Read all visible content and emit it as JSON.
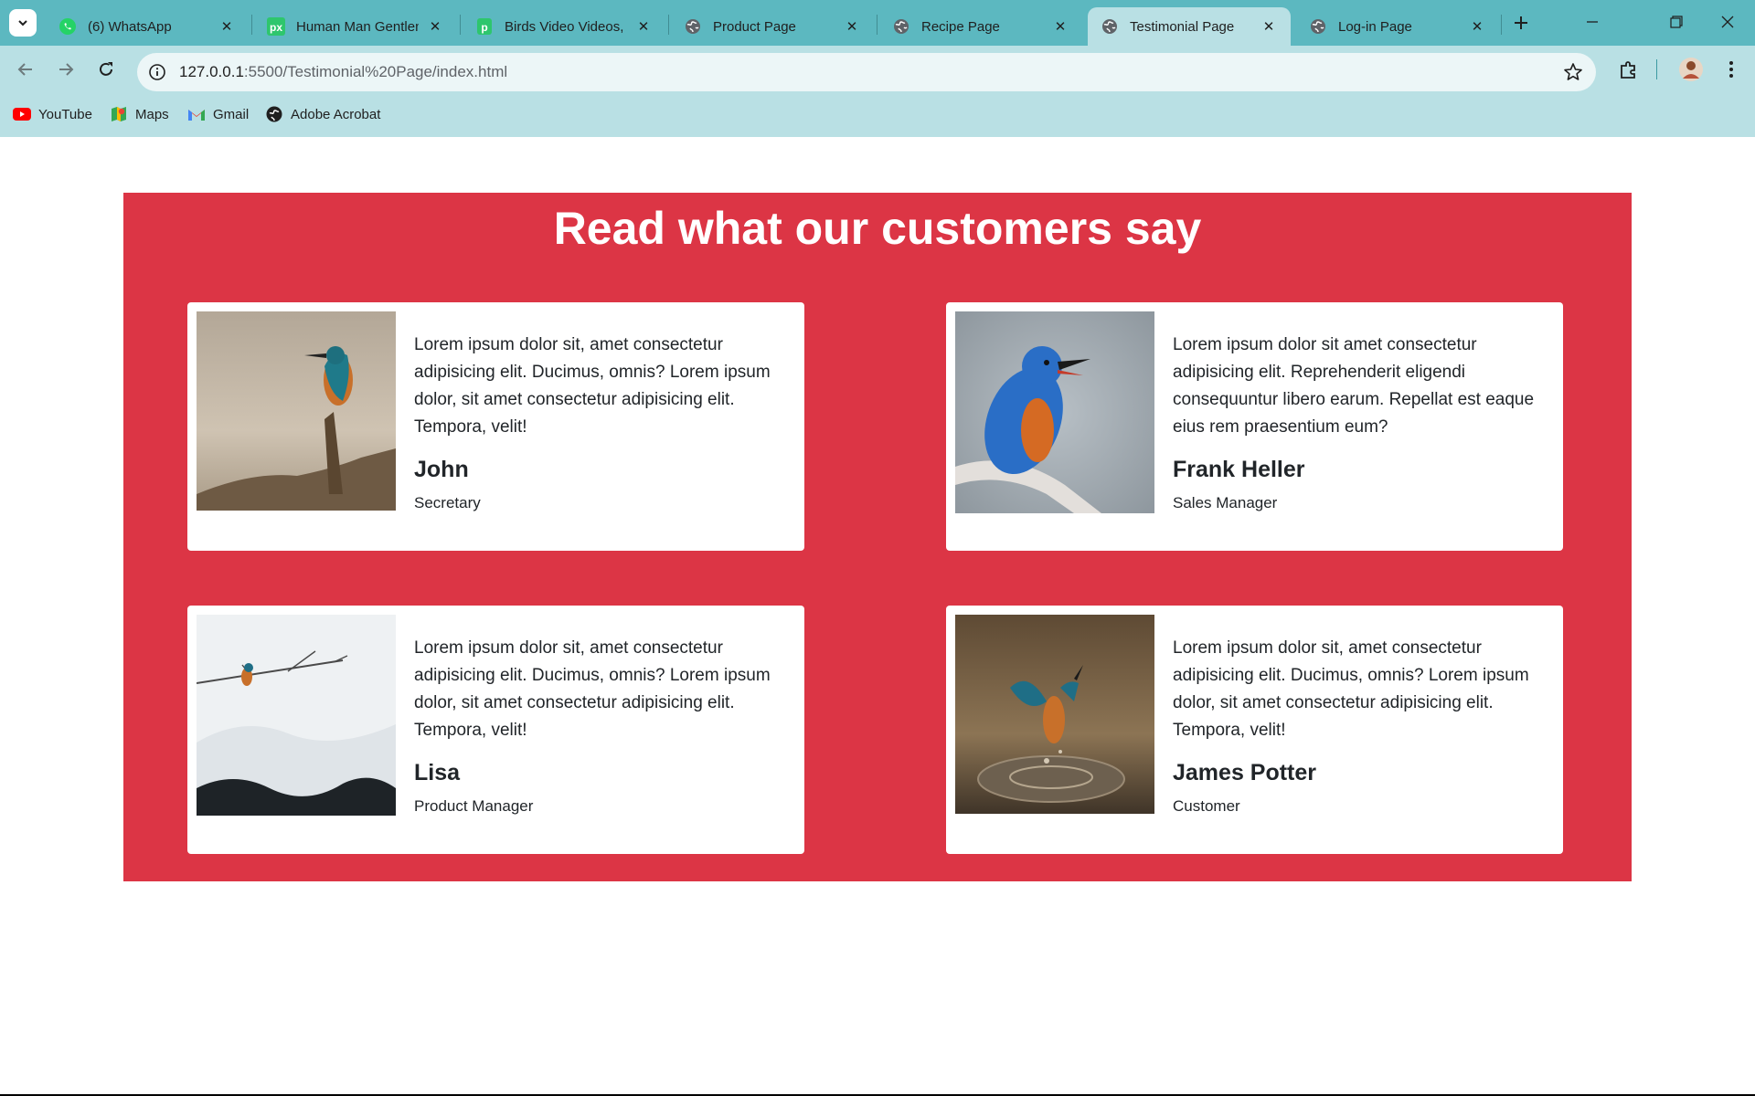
{
  "browser": {
    "tabs": [
      {
        "title": "(6) WhatsApp",
        "icon": "whatsapp-icon",
        "active": false
      },
      {
        "title": "Human Man Gentleman",
        "icon": "pixabay-icon",
        "active": false
      },
      {
        "title": "Birds Video Videos, D",
        "icon": "pixabay-video-icon",
        "active": false
      },
      {
        "title": "Product Page",
        "icon": "globe-icon",
        "active": false
      },
      {
        "title": "Recipe Page",
        "icon": "globe-icon",
        "active": false
      },
      {
        "title": "Testimonial Page",
        "icon": "globe-icon",
        "active": true
      },
      {
        "title": "Log-in Page",
        "icon": "globe-icon",
        "active": false
      }
    ],
    "address": {
      "host": "127.0.0.1",
      "path": ":5500/Testimonial%20Page/index.html"
    },
    "bookmarks": [
      {
        "label": "YouTube",
        "icon": "youtube-icon"
      },
      {
        "label": "Maps",
        "icon": "maps-icon"
      },
      {
        "label": "Gmail",
        "icon": "gmail-icon"
      },
      {
        "label": "Adobe Acrobat",
        "icon": "acrobat-icon"
      }
    ],
    "colors": {
      "tabstrip": "#5cb8c0",
      "toolbar": "#b9e0e4"
    }
  },
  "testimonials": {
    "heading": "Read what our customers say",
    "accent": "#dc3545",
    "items": [
      {
        "quote": "Lorem ipsum dolor sit, amet consectetur adipisicing elit. Ducimus, omnis? Lorem ipsum dolor, sit amet consectetur adipisicing elit. Tempora, velit!",
        "name": "John",
        "role": "Secretary"
      },
      {
        "quote": "Lorem ipsum dolor sit amet consectetur adipisicing elit. Reprehenderit eligendi consequuntur libero earum. Repellat est eaque eius rem praesentium eum?",
        "name": "Frank Heller",
        "role": "Sales Manager"
      },
      {
        "quote": "Lorem ipsum dolor sit, amet consectetur adipisicing elit. Ducimus, omnis? Lorem ipsum dolor, sit amet consectetur adipisicing elit. Tempora, velit!",
        "name": "Lisa",
        "role": "Product Manager"
      },
      {
        "quote": "Lorem ipsum dolor sit, amet consectetur adipisicing elit. Ducimus, omnis? Lorem ipsum dolor, sit amet consectetur adipisicing elit. Tempora, velit!",
        "name": "James Potter",
        "role": "Customer"
      }
    ]
  }
}
